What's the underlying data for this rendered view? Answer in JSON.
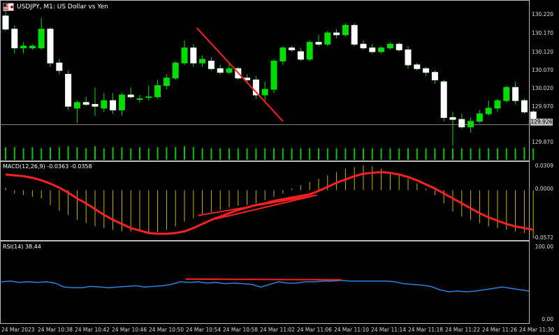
{
  "window": {
    "symbol": "USDJPY, M1:",
    "description": "US Dollar vs Yen",
    "flag_icon": "usd-jpy-flag-icon"
  },
  "colors": {
    "background": "#000000",
    "bull": "#ffffff",
    "bear": "#00dd00",
    "volume": "#00c800",
    "macd_hist": "#c8b400",
    "macd_signal": "#ff2020",
    "rsi_line": "#3080e0",
    "trendline": "#ff2020",
    "grid": "#ffffff"
  },
  "price_axis": {
    "labels": [
      "130.220",
      "130.170",
      "130.120",
      "130.070",
      "130.020",
      "129.970",
      "129.870"
    ],
    "current": "129.926"
  },
  "macd": {
    "label": "MACD(12,26,9) -0.0363 -0.0358",
    "axis": [
      "0.0309",
      "0.0000",
      "-0.0572"
    ]
  },
  "rsi": {
    "label": "RSI(14) 38.44",
    "axis": [
      "100.00",
      "0.00"
    ]
  },
  "time_axis": [
    "24 Mar 2023",
    "24 Mar 10:38",
    "24 Mar 10:42",
    "24 Mar 10:46",
    "24 Mar 10:50",
    "24 Mar 10:54",
    "24 Mar 10:58",
    "24 Mar 11:02",
    "24 Mar 11:06",
    "24 Mar 11:10",
    "24 Mar 11:14",
    "24 Mar 11:18",
    "24 Mar 11:22",
    "24 Mar 11:26",
    "24 Mar 11:30"
  ],
  "chart_data": {
    "type": "candlestick",
    "candles": [
      {
        "o": 130.215,
        "h": 130.235,
        "l": 130.175,
        "c": 130.18
      },
      {
        "o": 130.18,
        "h": 130.19,
        "l": 130.115,
        "c": 130.13
      },
      {
        "o": 130.13,
        "h": 130.145,
        "l": 130.115,
        "c": 130.135
      },
      {
        "o": 130.13,
        "h": 130.14,
        "l": 130.125,
        "c": 130.135
      },
      {
        "o": 130.13,
        "h": 130.21,
        "l": 130.125,
        "c": 130.18
      },
      {
        "o": 130.18,
        "h": 130.185,
        "l": 130.08,
        "c": 130.09
      },
      {
        "o": 130.09,
        "h": 130.1,
        "l": 130.06,
        "c": 130.07
      },
      {
        "o": 130.06,
        "h": 130.07,
        "l": 129.965,
        "c": 129.975
      },
      {
        "o": 129.97,
        "h": 129.99,
        "l": 129.93,
        "c": 129.985
      },
      {
        "o": 129.985,
        "h": 130.0,
        "l": 129.975,
        "c": 129.98
      },
      {
        "o": 129.98,
        "h": 130.025,
        "l": 129.95,
        "c": 129.975
      },
      {
        "o": 129.97,
        "h": 130.01,
        "l": 129.96,
        "c": 129.99
      },
      {
        "o": 129.99,
        "h": 130.01,
        "l": 129.955,
        "c": 129.965
      },
      {
        "o": 129.965,
        "h": 130.01,
        "l": 129.95,
        "c": 130.005
      },
      {
        "o": 130.005,
        "h": 130.025,
        "l": 129.995,
        "c": 130.0
      },
      {
        "o": 129.995,
        "h": 130.005,
        "l": 129.985,
        "c": 129.995
      },
      {
        "o": 130.0,
        "h": 130.03,
        "l": 129.99,
        "c": 130.0
      },
      {
        "o": 130.0,
        "h": 130.045,
        "l": 129.995,
        "c": 130.03
      },
      {
        "o": 130.03,
        "h": 130.06,
        "l": 130.02,
        "c": 130.05
      },
      {
        "o": 130.05,
        "h": 130.095,
        "l": 130.045,
        "c": 130.09
      },
      {
        "o": 130.09,
        "h": 130.15,
        "l": 130.085,
        "c": 130.13
      },
      {
        "o": 130.13,
        "h": 130.14,
        "l": 130.08,
        "c": 130.09
      },
      {
        "o": 130.09,
        "h": 130.11,
        "l": 130.08,
        "c": 130.1
      },
      {
        "o": 130.095,
        "h": 130.105,
        "l": 130.07,
        "c": 130.075
      },
      {
        "o": 130.075,
        "h": 130.085,
        "l": 130.06,
        "c": 130.065
      },
      {
        "o": 130.065,
        "h": 130.09,
        "l": 130.06,
        "c": 130.075
      },
      {
        "o": 130.075,
        "h": 130.08,
        "l": 130.045,
        "c": 130.05
      },
      {
        "o": 130.05,
        "h": 130.06,
        "l": 130.035,
        "c": 130.045
      },
      {
        "o": 130.045,
        "h": 130.055,
        "l": 129.995,
        "c": 130.005
      },
      {
        "o": 130.005,
        "h": 130.04,
        "l": 129.99,
        "c": 130.02
      },
      {
        "o": 130.02,
        "h": 130.1,
        "l": 130.01,
        "c": 130.095
      },
      {
        "o": 130.095,
        "h": 130.135,
        "l": 130.085,
        "c": 130.13
      },
      {
        "o": 130.13,
        "h": 130.135,
        "l": 130.12,
        "c": 130.125
      },
      {
        "o": 130.12,
        "h": 130.13,
        "l": 130.095,
        "c": 130.1
      },
      {
        "o": 130.1,
        "h": 130.15,
        "l": 130.095,
        "c": 130.145
      },
      {
        "o": 130.145,
        "h": 130.165,
        "l": 130.135,
        "c": 130.14
      },
      {
        "o": 130.14,
        "h": 130.175,
        "l": 130.135,
        "c": 130.17
      },
      {
        "o": 130.17,
        "h": 130.18,
        "l": 130.155,
        "c": 130.165
      },
      {
        "o": 130.165,
        "h": 130.195,
        "l": 130.16,
        "c": 130.19
      },
      {
        "o": 130.19,
        "h": 130.195,
        "l": 130.135,
        "c": 130.14
      },
      {
        "o": 130.14,
        "h": 130.15,
        "l": 130.125,
        "c": 130.13
      },
      {
        "o": 130.13,
        "h": 130.14,
        "l": 130.115,
        "c": 130.12
      },
      {
        "o": 130.12,
        "h": 130.135,
        "l": 130.115,
        "c": 130.13
      },
      {
        "o": 130.13,
        "h": 130.145,
        "l": 130.125,
        "c": 130.14
      },
      {
        "o": 130.14,
        "h": 130.145,
        "l": 130.12,
        "c": 130.125
      },
      {
        "o": 130.125,
        "h": 130.135,
        "l": 130.075,
        "c": 130.085
      },
      {
        "o": 130.085,
        "h": 130.09,
        "l": 130.07,
        "c": 130.075
      },
      {
        "o": 130.075,
        "h": 130.08,
        "l": 130.055,
        "c": 130.065
      },
      {
        "o": 130.065,
        "h": 130.07,
        "l": 130.035,
        "c": 130.045
      },
      {
        "o": 130.04,
        "h": 130.045,
        "l": 129.935,
        "c": 129.945
      },
      {
        "o": 129.945,
        "h": 129.96,
        "l": 129.87,
        "c": 129.94
      },
      {
        "o": 129.94,
        "h": 129.955,
        "l": 129.915,
        "c": 129.92
      },
      {
        "o": 129.92,
        "h": 129.945,
        "l": 129.905,
        "c": 129.935
      },
      {
        "o": 129.935,
        "h": 129.965,
        "l": 129.93,
        "c": 129.955
      },
      {
        "o": 129.955,
        "h": 129.99,
        "l": 129.95,
        "c": 129.97
      },
      {
        "o": 129.97,
        "h": 129.995,
        "l": 129.96,
        "c": 129.99
      },
      {
        "o": 129.99,
        "h": 130.03,
        "l": 129.985,
        "c": 130.025
      },
      {
        "o": 130.025,
        "h": 130.04,
        "l": 129.98,
        "c": 129.99
      },
      {
        "o": 129.99,
        "h": 129.995,
        "l": 129.955,
        "c": 129.96
      },
      {
        "o": 129.96,
        "h": 129.965,
        "l": 129.925,
        "c": 129.93
      }
    ],
    "volume": [
      0.6,
      0.6,
      0.55,
      0.6,
      0.55,
      0.6,
      0.6,
      0.65,
      0.6,
      0.55,
      0.65,
      0.55,
      0.6,
      0.6,
      0.55,
      0.6,
      0.55,
      0.6,
      0.6,
      0.6,
      0.65,
      0.6,
      0.55,
      0.55,
      0.55,
      0.55,
      0.55,
      0.55,
      0.55,
      0.55,
      0.55,
      0.55,
      0.55,
      0.55,
      0.55,
      0.55,
      0.55,
      0.55,
      0.55,
      0.55,
      0.55,
      0.55,
      0.55,
      0.55,
      0.55,
      0.55,
      0.55,
      0.55,
      0.55,
      0.55,
      0.55,
      0.55,
      0.55,
      0.55,
      0.55,
      0.55,
      0.55,
      0.55,
      0.6,
      0.55
    ],
    "macd_hist": [
      0.003,
      -0.004,
      -0.006,
      -0.008,
      -0.01,
      -0.018,
      -0.025,
      -0.03,
      -0.036,
      -0.04,
      -0.044,
      -0.046,
      -0.048,
      -0.05,
      -0.05,
      -0.05,
      -0.052,
      -0.051,
      -0.048,
      -0.044,
      -0.038,
      -0.034,
      -0.03,
      -0.027,
      -0.024,
      -0.021,
      -0.019,
      -0.018,
      -0.016,
      -0.012,
      -0.008,
      -0.004,
      0.002,
      0.006,
      0.01,
      0.014,
      0.018,
      0.022,
      0.026,
      0.028,
      0.03,
      0.029,
      0.026,
      0.022,
      0.018,
      0.014,
      0.008,
      0.002,
      -0.006,
      -0.016,
      -0.026,
      -0.032,
      -0.036,
      -0.04,
      -0.044,
      -0.046,
      -0.048,
      -0.05,
      -0.052,
      -0.058
    ],
    "macd_signal": [
      0.019,
      0.018,
      0.017,
      0.015,
      0.012,
      0.008,
      0.003,
      -0.003,
      -0.01,
      -0.016,
      -0.023,
      -0.03,
      -0.036,
      -0.041,
      -0.046,
      -0.049,
      -0.052,
      -0.053,
      -0.053,
      -0.052,
      -0.05,
      -0.046,
      -0.041,
      -0.036,
      -0.032,
      -0.028,
      -0.024,
      -0.021,
      -0.018,
      -0.016,
      -0.013,
      -0.011,
      -0.009,
      -0.007,
      -0.005,
      -0.001,
      0.004,
      0.009,
      0.013,
      0.017,
      0.02,
      0.021,
      0.022,
      0.021,
      0.019,
      0.016,
      0.012,
      0.007,
      0.002,
      -0.004,
      -0.01,
      -0.016,
      -0.022,
      -0.028,
      -0.033,
      -0.037,
      -0.041,
      -0.044,
      -0.046,
      -0.048
    ],
    "rsi": [
      54,
      55,
      53,
      54,
      53,
      54,
      52,
      46,
      45,
      45,
      47,
      46,
      45,
      46,
      47,
      48,
      46,
      47,
      48,
      50,
      54,
      53,
      54,
      52,
      53,
      51,
      52,
      51,
      50,
      46,
      50,
      54,
      52,
      52,
      54,
      54,
      55,
      55,
      56,
      55,
      55,
      55,
      55,
      55,
      54,
      51,
      50,
      49,
      47,
      42,
      39,
      40,
      39,
      40,
      42,
      44,
      46,
      44,
      42,
      40
    ],
    "trendlines": {
      "price": {
        "from_candle": 22,
        "from_price": 130.15,
        "to_candle": 31,
        "to_price": 129.95
      },
      "macd": [
        {
          "from_candle": 22,
          "from_val": -0.024,
          "to_candle": 34,
          "to_val": -0.006
        },
        {
          "from_candle": 24,
          "from_val": -0.028,
          "to_candle": 34,
          "to_val": -0.006
        }
      ],
      "rsi": {
        "from_candle": 22,
        "from_val": 58,
        "to_candle": 36,
        "to_val": 57
      }
    }
  }
}
